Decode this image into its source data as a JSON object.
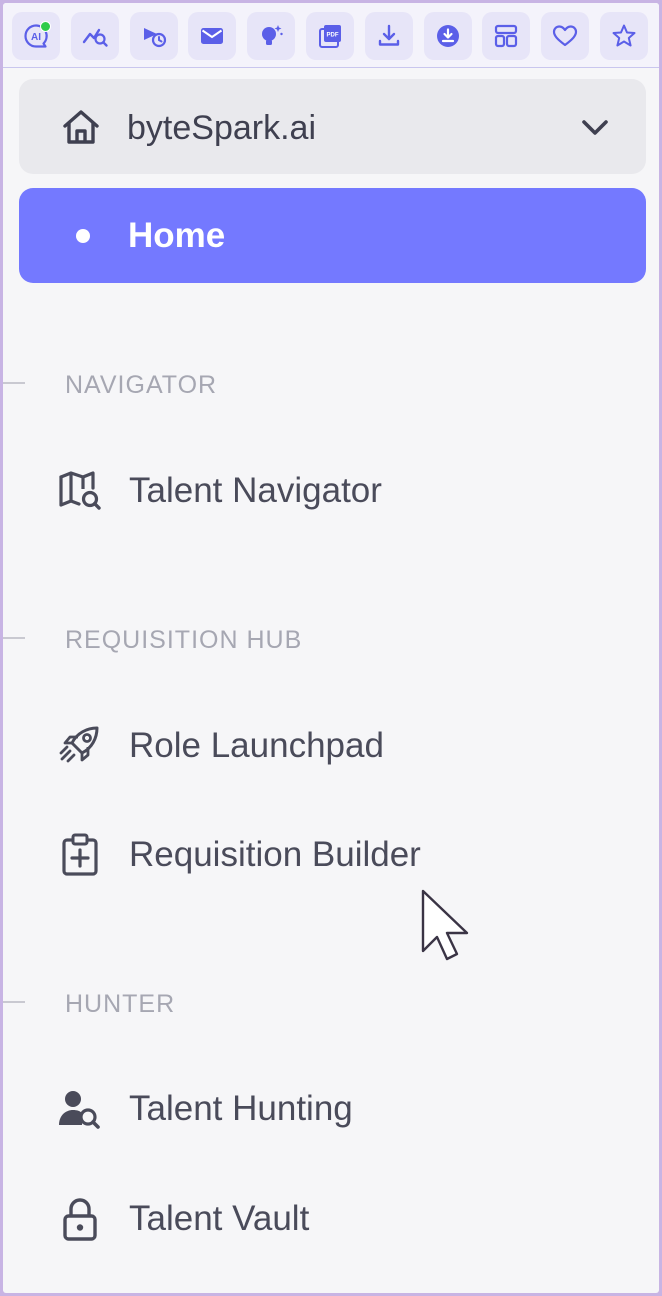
{
  "toolbar": {
    "buttons": [
      {
        "icon": "ai-chat-icon"
      },
      {
        "icon": "analytics-search-icon"
      },
      {
        "icon": "fast-history-icon"
      },
      {
        "icon": "mail-icon"
      },
      {
        "icon": "idea-bulb-icon"
      },
      {
        "icon": "pdf-icon",
        "text": "PDF"
      },
      {
        "icon": "download-icon"
      },
      {
        "icon": "download-circle-icon"
      },
      {
        "icon": "layout-icon"
      },
      {
        "icon": "heart-icon"
      },
      {
        "icon": "star-icon"
      }
    ],
    "ai_badge": "AI",
    "accent_color": "#5b5fe8",
    "status_dot_color": "#2fcc4a"
  },
  "workspace": {
    "name": "byteSpark.ai",
    "icon": "home-icon",
    "chevron": "chevron-down-icon"
  },
  "home": {
    "label": "Home",
    "active_color": "#7479ff"
  },
  "sections": [
    {
      "title": "NAVIGATOR",
      "items": [
        {
          "label": "Talent Navigator",
          "icon": "map-search-icon"
        }
      ]
    },
    {
      "title": "REQUISITION HUB",
      "items": [
        {
          "label": "Role Launchpad",
          "icon": "rocket-icon"
        },
        {
          "label": "Requisition Builder",
          "icon": "clipboard-plus-icon"
        }
      ]
    },
    {
      "title": "HUNTER",
      "items": [
        {
          "label": "Talent Hunting",
          "icon": "user-search-icon"
        },
        {
          "label": "Talent Vault",
          "icon": "lock-icon"
        }
      ]
    }
  ]
}
